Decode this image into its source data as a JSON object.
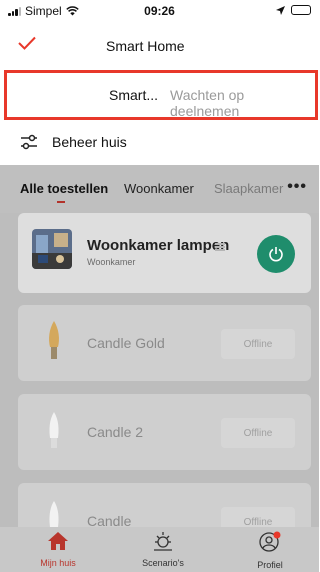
{
  "status_bar": {
    "carrier": "Simpel",
    "time": "09:26"
  },
  "home_menu": {
    "current_home": "Smart Home",
    "pending_home": {
      "name": "Smart...",
      "status": "Wachten op deelnemen"
    },
    "manage_label": "Beheer huis"
  },
  "tabs": [
    {
      "label": "Alle toestellen",
      "active": true
    },
    {
      "label": "Woonkamer",
      "active": false
    },
    {
      "label": "Slaapkamer",
      "active": false
    }
  ],
  "devices": [
    {
      "name": "Woonkamer lampen",
      "room": "Woonkamer",
      "state": "power"
    },
    {
      "name": "Candle Gold",
      "state": "Offline"
    },
    {
      "name": "Candle 2",
      "state": "Offline"
    },
    {
      "name": "Candle",
      "state": "Offline"
    }
  ],
  "bottom_nav": [
    {
      "label": "Mijn huis",
      "icon": "home-icon",
      "active": true
    },
    {
      "label": "Scenario's",
      "icon": "sun-icon",
      "active": false
    },
    {
      "label": "Profiel",
      "icon": "profile-icon",
      "active": false
    }
  ],
  "colors": {
    "accent_red": "#e8382a",
    "power_green": "#1f8d6c",
    "active_nav": "#b8352c"
  }
}
